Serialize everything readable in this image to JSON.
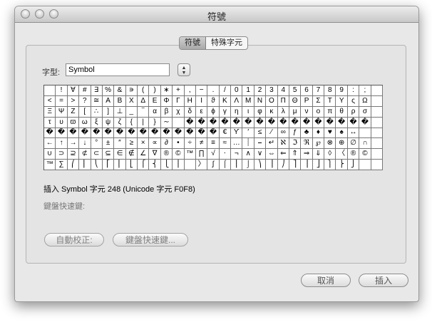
{
  "window": {
    "title": "符號"
  },
  "tabs": [
    {
      "label": "符號",
      "active": true
    },
    {
      "label": "特殊字元",
      "active": false
    }
  ],
  "font": {
    "label": "字型:",
    "value": "Symbol"
  },
  "symbol_rows": [
    [
      "",
      "!",
      "∀",
      "#",
      "∃",
      "%",
      "&",
      "∍",
      "(",
      ")",
      "∗",
      "+",
      ",",
      "−",
      ".",
      "/",
      "0",
      "1",
      "2",
      "3",
      "4",
      "5",
      "6",
      "7",
      "8",
      "9",
      ":",
      ";"
    ],
    [
      "<",
      "=",
      ">",
      "?",
      "≅",
      "Α",
      "Β",
      "Χ",
      "Δ",
      "Ε",
      "Φ",
      "Γ",
      "Η",
      "Ι",
      "ϑ",
      "Κ",
      "Λ",
      "Μ",
      "Ν",
      "Ο",
      "Π",
      "Θ",
      "Ρ",
      "Σ",
      "Τ",
      "Υ",
      "ς",
      "Ω"
    ],
    [
      "Ξ",
      "Ψ",
      "Ζ",
      "[",
      "∴",
      "]",
      "⊥",
      "_",
      "‾",
      "α",
      "β",
      "χ",
      "δ",
      "ε",
      "ϕ",
      "γ",
      "η",
      "ι",
      "φ",
      "κ",
      "λ",
      "μ",
      "ν",
      "ο",
      "π",
      "θ",
      "ρ",
      "σ"
    ],
    [
      "τ",
      "υ",
      "ϖ",
      "ω",
      "ξ",
      "ψ",
      "ζ",
      "{",
      "|",
      "}",
      "∼",
      "",
      "�",
      "�",
      "�",
      "�",
      "�",
      "�",
      "�",
      "�",
      "�",
      "�",
      "�",
      "�",
      "�",
      "�",
      "�",
      "�"
    ],
    [
      "�",
      "�",
      "�",
      "�",
      "�",
      "�",
      "�",
      "�",
      "�",
      "�",
      "�",
      "�",
      "�",
      "�",
      "�",
      "€",
      "ϒ",
      "′",
      "≤",
      "⁄",
      "∞",
      "ƒ",
      "♣",
      "♦",
      "♥",
      "♠",
      "↔"
    ],
    [
      "←",
      "↑",
      "→",
      "↓",
      "°",
      "±",
      "″",
      "≥",
      "×",
      "∝",
      "∂",
      "•",
      "÷",
      "≠",
      "≡",
      "≈",
      "…",
      "⏐",
      "⎯",
      "↵",
      "ℵ",
      "ℑ",
      "ℜ",
      "℘",
      "⊗",
      "⊕",
      "∅",
      "∩"
    ],
    [
      "∪",
      "⊃",
      "⊇",
      "⊄",
      "⊂",
      "⊆",
      "∈",
      "∉",
      "∠",
      "∇",
      "®",
      "©",
      "™",
      "∏",
      "√",
      "⋅",
      "¬",
      "∧",
      "∨",
      "⇔",
      "⇐",
      "⇑",
      "⇒",
      "⇓",
      "◊",
      "〈",
      "®",
      "©"
    ],
    [
      "™",
      "∑",
      "⎛",
      "⎜",
      "⎝",
      "⎡",
      "⎢",
      "⎣",
      "⎧",
      "⎨",
      "⎩",
      "⎪",
      "",
      "〉",
      "∫",
      "⌠",
      "⎮",
      "⌡",
      "⎞",
      "⎟",
      "⎠",
      "⎤",
      "⎥",
      "⎦",
      "⎫",
      "⎬",
      "⎭",
      ""
    ]
  ],
  "selected_info": "插入 Symbol 字元 248  (Unicode 字元 F0F8)",
  "shortcut_label": "鍵盤快速鍵:",
  "buttons": {
    "autocorrect": "自動校正:",
    "shortcut": "鍵盤快速鍵...",
    "cancel": "取消",
    "insert": "插入"
  }
}
